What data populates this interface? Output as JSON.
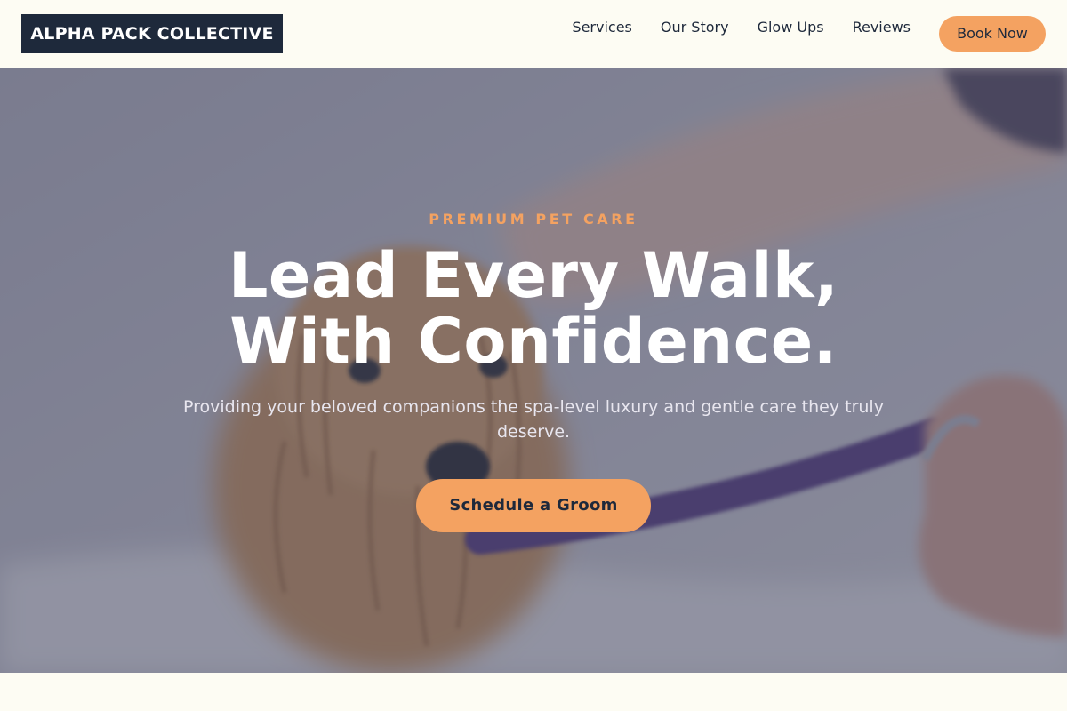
{
  "header": {
    "logo_text": "ALPHA PACK COLLECTIVE",
    "nav": [
      {
        "label": "Services"
      },
      {
        "label": "Our Story"
      },
      {
        "label": "Glow Ups"
      },
      {
        "label": "Reviews"
      }
    ],
    "book_label": "Book Now"
  },
  "hero": {
    "eyebrow": "PREMIUM PET CARE",
    "headline_line1": "Lead Every Walk,",
    "headline_line2": "With Confidence.",
    "subtext": "Providing your beloved companions the spa-level luxury and gentle care they truly deserve.",
    "cta_label": "Schedule a Groom"
  },
  "colors": {
    "accent": "#f4a261",
    "navy": "#1e293b",
    "cream": "#fdfcf3"
  }
}
